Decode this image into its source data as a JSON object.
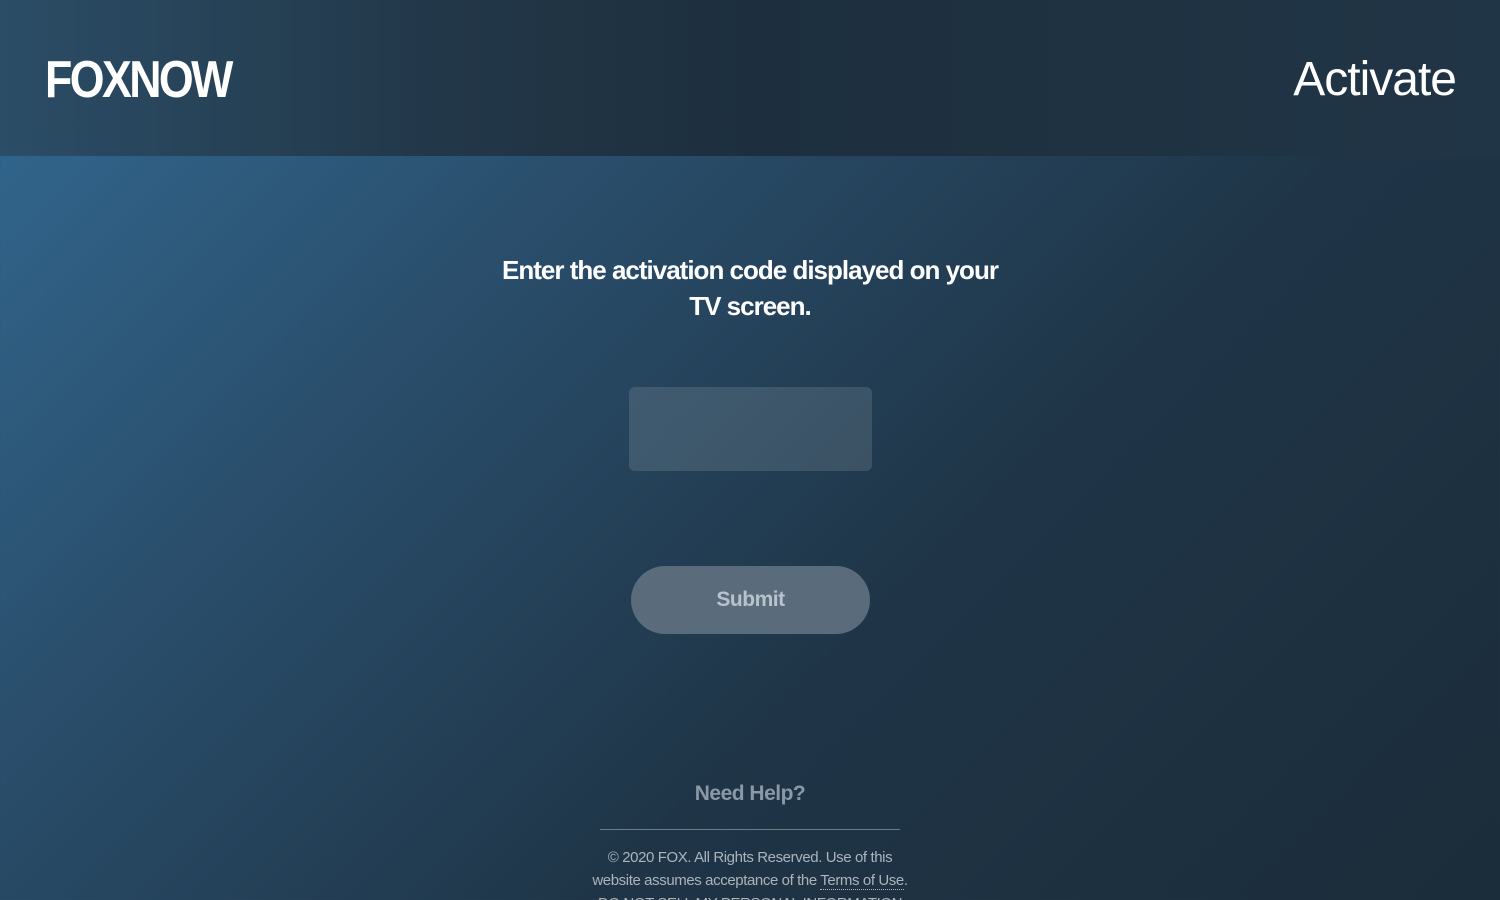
{
  "header": {
    "logo_text": "FOXNOW",
    "title": "Activate"
  },
  "main": {
    "instructions": "Enter the activation code displayed on your TV screen.",
    "code_input": {
      "value": "",
      "placeholder": ""
    },
    "submit_label": "Submit"
  },
  "footer": {
    "help_label": "Need Help?",
    "copyright_text": "© 2020 FOX. All Rights Reserved. Use of this website assumes acceptance of the",
    "terms_label": "Terms of Use",
    "terms_suffix": ".",
    "dns_label": "Do Not Sell My Personal Information"
  },
  "colors": {
    "background_light": "#336a93",
    "background_dark": "#1b2c3a",
    "submit_button": "#5a6c7b",
    "help_text": "#8b99a6"
  }
}
